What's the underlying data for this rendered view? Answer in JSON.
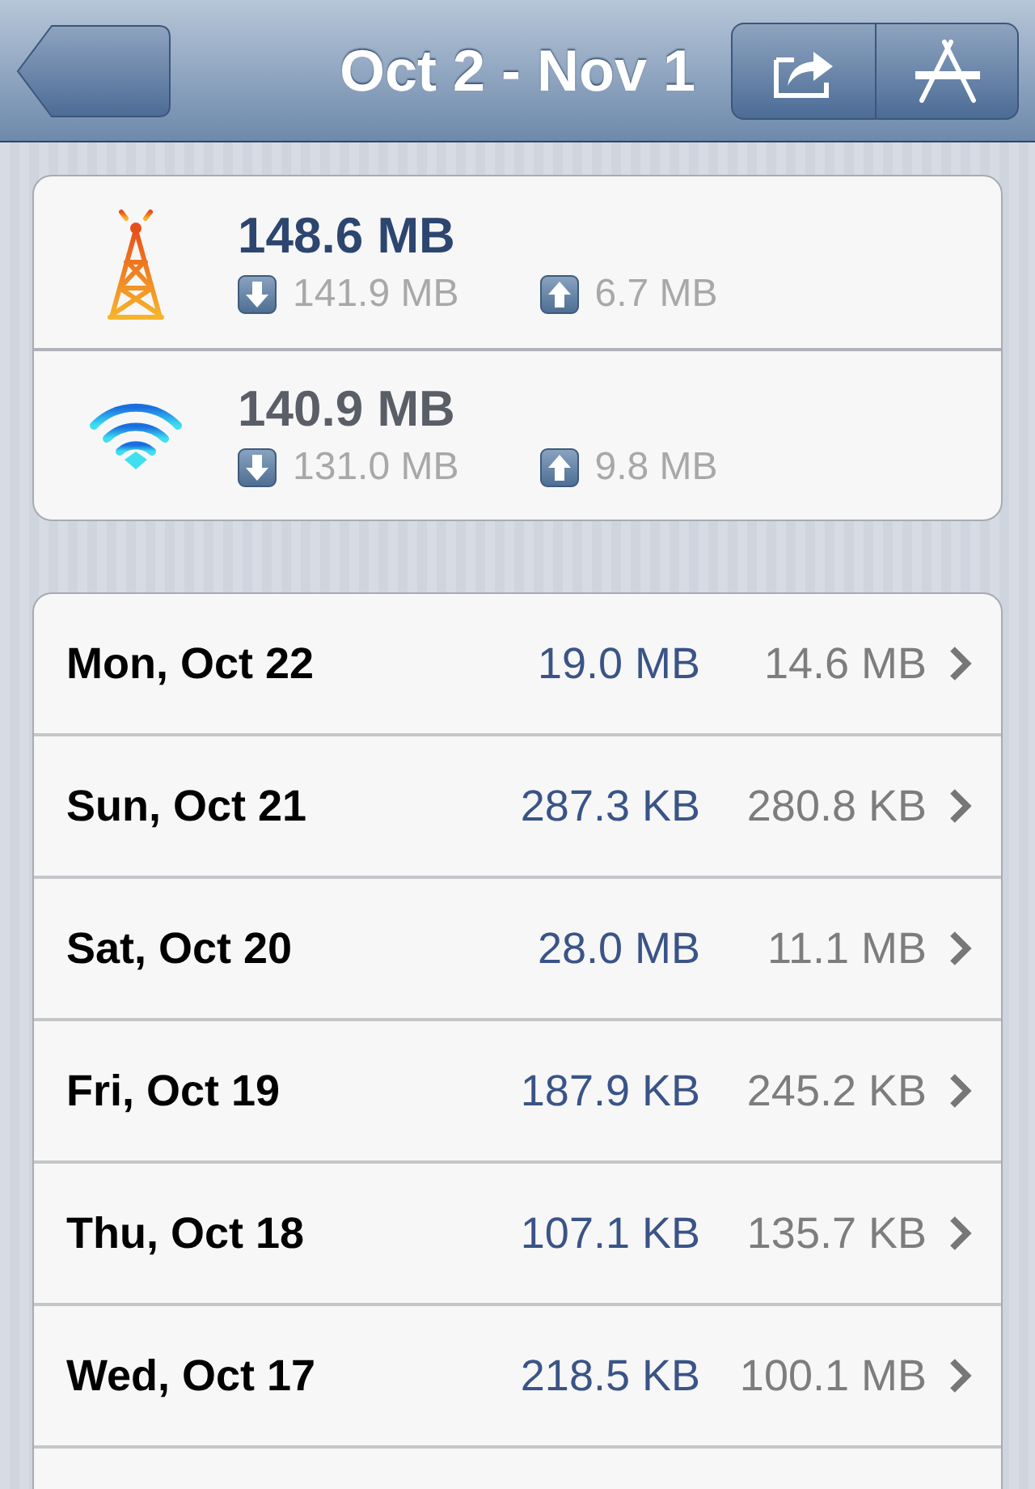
{
  "nav_bar": {
    "title": "Oct 2 - Nov 1"
  },
  "summary": [
    {
      "kind": "cellular",
      "total": "148.6 MB",
      "download": "141.9 MB",
      "upload": "6.7 MB"
    },
    {
      "kind": "wifi",
      "total": "140.9 MB",
      "download": "131.0 MB",
      "upload": "9.8 MB"
    }
  ],
  "days": [
    {
      "date": "Mon, Oct 22",
      "column_2": "19.0 MB",
      "column_3": "14.6 MB"
    },
    {
      "date": "Sun, Oct 21",
      "column_2": "287.3 KB",
      "column_3": "280.8 KB"
    },
    {
      "date": "Sat, Oct 20",
      "column_2": "28.0 MB",
      "column_3": "11.1 MB"
    },
    {
      "date": "Fri, Oct 19",
      "column_2": "187.9 KB",
      "column_3": "245.2 KB"
    },
    {
      "date": "Thu, Oct 18",
      "column_2": "107.1 KB",
      "column_3": "135.7 KB"
    },
    {
      "date": "Wed, Oct 17",
      "column_2": "218.5 KB",
      "column_3": "100.1 MB"
    }
  ]
}
